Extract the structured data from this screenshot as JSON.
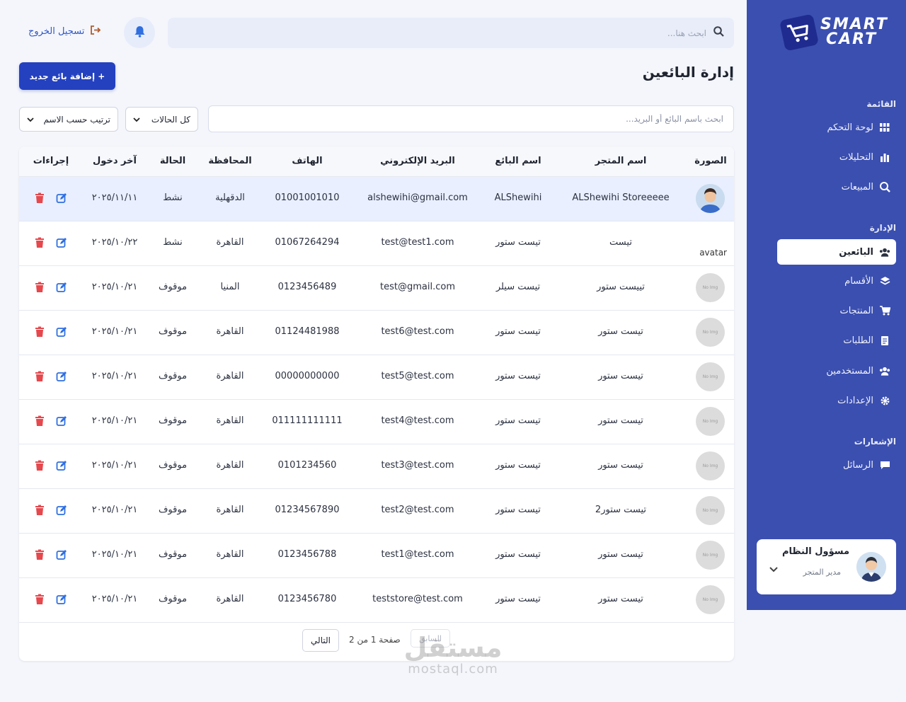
{
  "brand": {
    "line1": "SMART",
    "line2": "CART",
    "badge_color": "#1f2b8f"
  },
  "sidebar": {
    "bg_color": "#3b4fb0",
    "sections": [
      {
        "title": "القائمة"
      },
      {
        "title": "الإدارة"
      },
      {
        "title": "الإشعارات"
      }
    ],
    "items": [
      {
        "label": "لوحة التحكم",
        "icon": "grid-icon"
      },
      {
        "label": "التحليلات",
        "icon": "bar-chart-icon"
      },
      {
        "label": "المبيعات",
        "icon": "search-chart-icon"
      },
      {
        "label": "البائعين",
        "icon": "users-icon",
        "active": true
      },
      {
        "label": "الأقسام",
        "icon": "layers-icon"
      },
      {
        "label": "المنتجات",
        "icon": "cart-icon"
      },
      {
        "label": "الطلبات",
        "icon": "receipt-icon"
      },
      {
        "label": "المستخدمين",
        "icon": "users-icon"
      },
      {
        "label": "الإعدادات",
        "icon": "gear-icon"
      },
      {
        "label": "الرسائل",
        "icon": "chat-icon"
      }
    ],
    "user": {
      "name": "مسؤول النظام",
      "role": "مدير المتجر"
    }
  },
  "topbar": {
    "logout_label": "تسجيل الخروج",
    "search_placeholder": "ابحث هنا..."
  },
  "page": {
    "title": "إدارة البائعين",
    "add_button": "+ إضافة بائع جديد",
    "filter_placeholder": "ابحث باسم البائع أو البريد...",
    "status_filter": "كل الحالات",
    "sort_filter": "ترتيب حسب الاسم"
  },
  "table": {
    "headers": {
      "image": "الصورة",
      "store": "اسم المتجر",
      "seller": "اسم البائع",
      "email": "البريد الإلكتروني",
      "phone": "الهاتف",
      "governorate": "المحافظة",
      "status": "الحالة",
      "last_login": "آخر دخول",
      "actions": "إجراءات"
    },
    "rows": [
      {
        "avatar": "photo",
        "avatar_text": "",
        "store": "ALShewihi Storeeeee",
        "seller": "ALShewihi",
        "email": "alshewihi@gmail.com",
        "phone": "01001001010",
        "governorate": "الدقهلية",
        "status": "نشط",
        "last_login": "٢٠٢٥/١١/١١"
      },
      {
        "avatar": "broken",
        "avatar_text": "avatar",
        "store": "تيست",
        "seller": "تيست ستور",
        "email": "test@test1.com",
        "phone": "01067264294",
        "governorate": "القاهرة",
        "status": "نشط",
        "last_login": "٢٠٢٥/١٠/٢٢"
      },
      {
        "avatar": "none",
        "avatar_text": "No Img",
        "store": "تييست ستور",
        "seller": "تيست سيلر",
        "email": "test@gmail.com",
        "phone": "0123456489",
        "governorate": "المنيا",
        "status": "موقوف",
        "last_login": "٢٠٢٥/١٠/٢١"
      },
      {
        "avatar": "none",
        "avatar_text": "No Img",
        "store": "تيست ستور",
        "seller": "تيست ستور",
        "email": "test6@test.com",
        "phone": "01124481988",
        "governorate": "القاهرة",
        "status": "موقوف",
        "last_login": "٢٠٢٥/١٠/٢١"
      },
      {
        "avatar": "none",
        "avatar_text": "No Img",
        "store": "تيست ستور",
        "seller": "تيست ستور",
        "email": "test5@test.com",
        "phone": "00000000000",
        "governorate": "القاهرة",
        "status": "موقوف",
        "last_login": "٢٠٢٥/١٠/٢١"
      },
      {
        "avatar": "none",
        "avatar_text": "No Img",
        "store": "تيست ستور",
        "seller": "تيست ستور",
        "email": "test4@test.com",
        "phone": "011111111111",
        "governorate": "القاهرة",
        "status": "موقوف",
        "last_login": "٢٠٢٥/١٠/٢١"
      },
      {
        "avatar": "none",
        "avatar_text": "No Img",
        "store": "تيست ستور",
        "seller": "تيست ستور",
        "email": "test3@test.com",
        "phone": "0101234560",
        "governorate": "القاهرة",
        "status": "موقوف",
        "last_login": "٢٠٢٥/١٠/٢١"
      },
      {
        "avatar": "none",
        "avatar_text": "No Img",
        "store": "تيست ستور2",
        "seller": "تيست ستور",
        "email": "test2@test.com",
        "phone": "01234567890",
        "governorate": "القاهرة",
        "status": "موقوف",
        "last_login": "٢٠٢٥/١٠/٢١"
      },
      {
        "avatar": "none",
        "avatar_text": "No Img",
        "store": "تيست ستور",
        "seller": "تيست ستور",
        "email": "test1@test.com",
        "phone": "0123456788",
        "governorate": "القاهرة",
        "status": "موقوف",
        "last_login": "٢٠٢٥/١٠/٢١"
      },
      {
        "avatar": "none",
        "avatar_text": "No Img",
        "store": "تيست ستور",
        "seller": "تيست ستور",
        "email": "teststore@test.com",
        "phone": "0123456780",
        "governorate": "القاهرة",
        "status": "موقوف",
        "last_login": "٢٠٢٥/١٠/٢١"
      }
    ]
  },
  "pagination": {
    "prev": "السابق",
    "info": "صفحة 1 من 2",
    "next": "التالي"
  },
  "watermark": {
    "big": "مستقل",
    "small": "mostaql.com"
  },
  "colors": {
    "primary": "#2441c0",
    "edit": "#2f6fe0",
    "delete": "#e5484d",
    "row_highlight": "#e9efff"
  }
}
